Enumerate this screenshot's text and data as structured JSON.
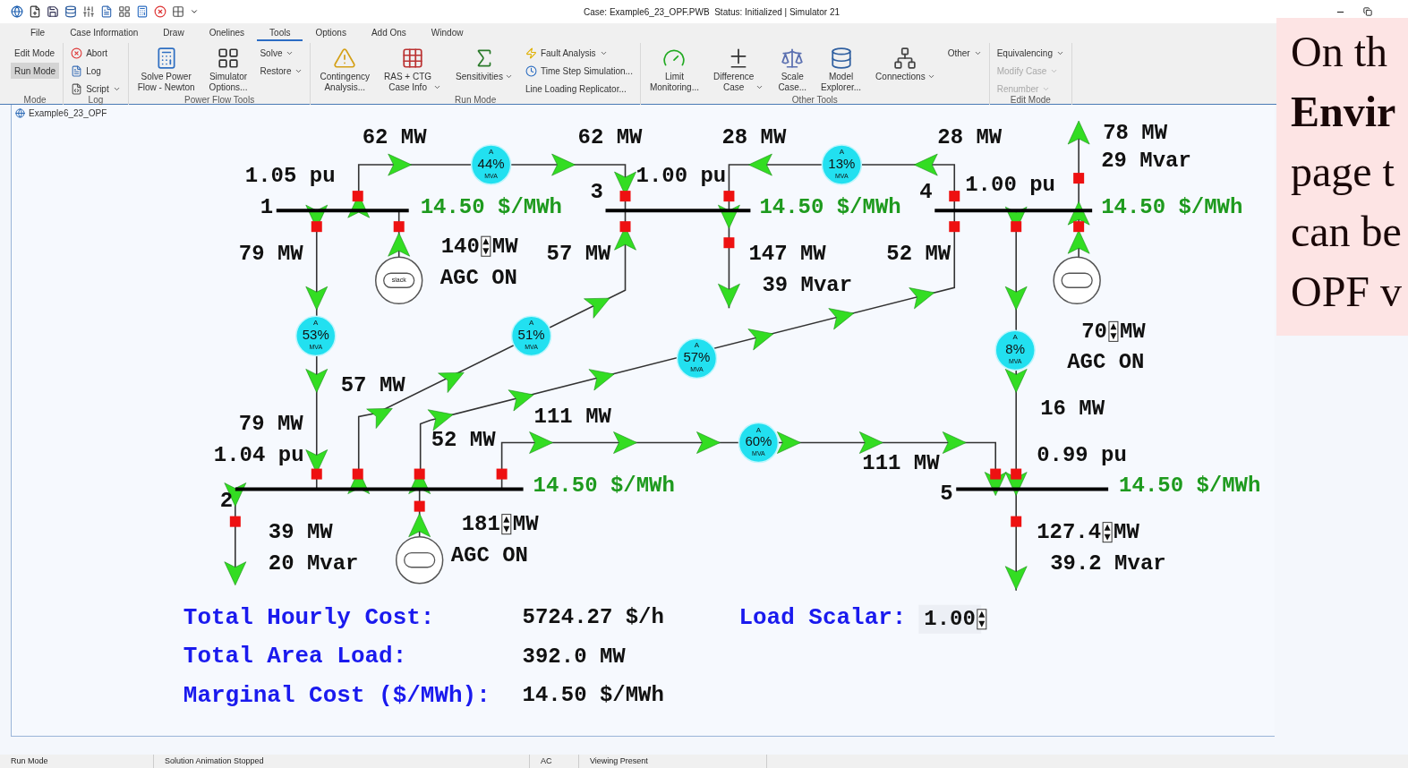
{
  "window": {
    "title": "Case: Example6_23_OPF.PWB  Status: Initialized | Simulator 21"
  },
  "ribbon": {
    "tabs": [
      {
        "label": "File",
        "selected": false
      },
      {
        "label": "Case Information",
        "selected": false
      },
      {
        "label": "Draw",
        "selected": false
      },
      {
        "label": "Onelines",
        "selected": false
      },
      {
        "label": "Tools",
        "selected": true
      },
      {
        "label": "Options",
        "selected": false
      },
      {
        "label": "Add Ons",
        "selected": false
      },
      {
        "label": "Window",
        "selected": false
      }
    ],
    "groups": [
      {
        "label": "Mode",
        "items": [
          {
            "label": "Edit Mode",
            "kind": "small",
            "selected": false
          },
          {
            "label": "Run Mode",
            "kind": "small",
            "selected": true
          }
        ]
      },
      {
        "label": "Log",
        "items": [
          {
            "label": "Abort",
            "kind": "small"
          },
          {
            "label": "Log",
            "kind": "small"
          },
          {
            "label": "Script",
            "kind": "small",
            "dropdown": true
          }
        ]
      },
      {
        "label": "Power Flow Tools",
        "items": [
          {
            "label": "Solve Power\nFlow - Newton",
            "kind": "large"
          },
          {
            "label": "Simulator\nOptions...",
            "kind": "large"
          },
          {
            "label": "Solve",
            "kind": "small",
            "dropdown": true
          },
          {
            "label": "Restore",
            "kind": "small",
            "dropdown": true
          }
        ]
      },
      {
        "label": "Run Mode",
        "items": [
          {
            "label": "Contingency\nAnalysis...",
            "kind": "large"
          },
          {
            "label": "RAS + CTG\nCase Info",
            "kind": "large",
            "dropdown": true
          },
          {
            "label": "Sensitivities",
            "kind": "large",
            "dropdown": true
          },
          {
            "label": "Fault Analysis",
            "kind": "small",
            "dropdown": true
          },
          {
            "label": "Time Step Simulation...",
            "kind": "small"
          },
          {
            "label": "Line Loading Replicator...",
            "kind": "small"
          }
        ]
      },
      {
        "label": "Other Tools",
        "items": [
          {
            "label": "Limit\nMonitoring...",
            "kind": "large"
          },
          {
            "label": "Difference\nCase",
            "kind": "large",
            "dropdown": true
          },
          {
            "label": "Scale\nCase...",
            "kind": "large"
          },
          {
            "label": "Model\nExplorer...",
            "kind": "large"
          },
          {
            "label": "Connections",
            "kind": "large",
            "dropdown": true
          },
          {
            "label": "Other",
            "kind": "small",
            "dropdown": true
          }
        ]
      },
      {
        "label": "Edit Mode",
        "items": [
          {
            "label": "Equivalencing",
            "kind": "small",
            "dropdown": true,
            "disabled": false
          },
          {
            "label": "Modify Case",
            "kind": "small",
            "dropdown": true,
            "disabled": true
          },
          {
            "label": "Renumber",
            "kind": "small",
            "dropdown": true,
            "disabled": true
          }
        ]
      }
    ]
  },
  "document_tab": "Example6_23_OPF",
  "oneline": {
    "buses": [
      {
        "number": "1",
        "voltage": "1.05 pu",
        "price": "14.50 $/MWh"
      },
      {
        "number": "2",
        "voltage": "1.04 pu",
        "price": "14.50 $/MWh"
      },
      {
        "number": "3",
        "voltage": "1.00 pu",
        "price": "14.50 $/MWh"
      },
      {
        "number": "4",
        "voltage": "1.00 pu",
        "price": "14.50 $/MWh"
      },
      {
        "number": "5",
        "voltage": "0.99 pu",
        "price": "14.50 $/MWh"
      }
    ],
    "flow_labels": [
      "62 MW",
      "62 MW",
      "28 MW",
      "28 MW",
      "78 MW",
      "29 Mvar",
      "79 MW",
      "57 MW",
      "52 MW",
      "57 MW",
      "79 MW",
      "52 MW",
      "111 MW",
      "111 MW",
      "16 MW"
    ],
    "pies": [
      {
        "top": "A",
        "percent": "44%",
        "unit": "MVA"
      },
      {
        "top": "A",
        "percent": "13%",
        "unit": "MVA"
      },
      {
        "top": "A",
        "percent": "53%",
        "unit": "MVA"
      },
      {
        "top": "A",
        "percent": "51%",
        "unit": "MVA"
      },
      {
        "top": "A",
        "percent": "57%",
        "unit": "MVA"
      },
      {
        "top": "A",
        "percent": "8%",
        "unit": "MVA"
      },
      {
        "top": "A",
        "percent": "60%",
        "unit": "MVA"
      }
    ],
    "generators": [
      {
        "mw": "140",
        "unit": "MW",
        "agc": "AGC ON",
        "tag": "slack"
      },
      {
        "mw": "181",
        "unit": "MW",
        "agc": "AGC ON"
      },
      {
        "mw": "70",
        "unit": "MW",
        "agc": "AGC ON"
      }
    ],
    "loads": [
      {
        "mw": "147",
        "unit": "MW",
        "mvar": "39 Mvar",
        "adjustable": false
      },
      {
        "mw": "39",
        "unit": "MW",
        "mvar": "20 Mvar",
        "adjustable": false
      },
      {
        "mw": "127.4",
        "unit": "MW",
        "mvar": "39.2 Mvar",
        "adjustable": true
      }
    ],
    "summary": [
      {
        "label": "Total Hourly Cost:",
        "value": "5724.27 $/h"
      },
      {
        "label": "Total Area Load:",
        "value": "392.0 MW"
      },
      {
        "label": "Marginal Cost ($/MWh):",
        "value": "14.50 $/MWh"
      }
    ],
    "load_scalar": {
      "label": "Load Scalar:",
      "value": "1.00"
    }
  },
  "note": "On th\n**Envir**\npage t\ncan be\nOPF v",
  "status_bar": [
    "Run Mode",
    "Solution Animation Stopped",
    "AC",
    "Viewing Present"
  ]
}
